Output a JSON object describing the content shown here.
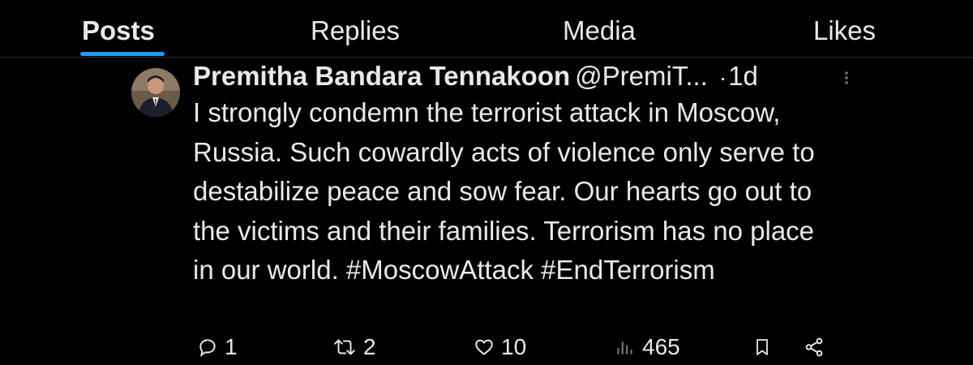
{
  "tabs": [
    {
      "label": "Posts",
      "active": true
    },
    {
      "label": "Replies",
      "active": false
    },
    {
      "label": "Media",
      "active": false
    },
    {
      "label": "Likes",
      "active": false
    }
  ],
  "post": {
    "author_name": "Premitha Bandara Tennakoon",
    "handle": "@PremiT...",
    "separator": "·",
    "time": "1d",
    "text": "I strongly condemn the terrorist attack in Moscow, Russia. Such cowardly acts of violence only serve to destabilize peace and sow fear. Our hearts go out to the victims and their families. Terrorism has no place in our world.",
    "hashtags": "#MoscowAttack #EndTerrorism",
    "actions": {
      "replies": "1",
      "reposts": "2",
      "likes": "10",
      "views": "465"
    }
  },
  "colors": {
    "background": "#000000",
    "text": "#e7e9ea",
    "accent": "#1d9bf0",
    "divider": "#2f3336"
  },
  "icons": [
    "reply-icon",
    "repost-icon",
    "like-icon",
    "views-icon",
    "bookmark-icon",
    "share-icon",
    "more-icon"
  ]
}
